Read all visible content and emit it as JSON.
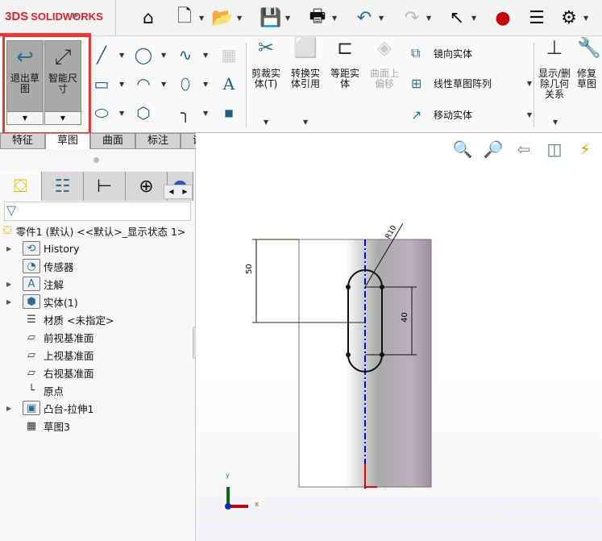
{
  "app": {
    "logo": "SOLIDWORKS",
    "logo_prefix": "3DS"
  },
  "quick_toolbar": [
    {
      "icon": "home-icon",
      "glyph": "⌂"
    },
    {
      "icon": "new-document-icon",
      "glyph": "🗋"
    },
    {
      "icon": "open-folder-icon",
      "glyph": "📂"
    },
    {
      "icon": "save-icon",
      "glyph": "💾"
    },
    {
      "icon": "print-icon",
      "glyph": "🖶"
    },
    {
      "icon": "undo-icon",
      "glyph": "↶"
    },
    {
      "icon": "redo-icon",
      "glyph": "↷"
    },
    {
      "icon": "select-pointer-icon",
      "glyph": "↖"
    },
    {
      "icon": "rebuild-traffic-light-icon",
      "glyph": "●"
    },
    {
      "icon": "file-properties-icon",
      "glyph": "☰"
    },
    {
      "icon": "options-gear-icon",
      "glyph": "⚙"
    }
  ],
  "ribbon": {
    "exit_sketch": "退出草图",
    "smart_dimension": "智能尺寸",
    "trim": "剪裁实体(T)",
    "convert": "转换实体引用",
    "offset": "等距实体",
    "surface_offset": "曲面上偏移",
    "mirror": "镜向实体",
    "linear_pattern": "线性草图阵列",
    "move": "移动实体",
    "display_relations": "显示/删除几何关系",
    "repair": "修复草图"
  },
  "tabs": [
    {
      "label": "特征"
    },
    {
      "label": "草图",
      "active": true
    },
    {
      "label": "曲面"
    },
    {
      "label": "标注"
    },
    {
      "label": "评估"
    }
  ],
  "tree": {
    "root": "零件1 (默认) <<默认>_显示状态 1>",
    "items": [
      {
        "label": "History",
        "expandable": true,
        "icon": "history-folder-icon"
      },
      {
        "label": "传感器",
        "expandable": false,
        "icon": "sensor-folder-icon"
      },
      {
        "label": "注解",
        "expandable": true,
        "icon": "annotations-folder-icon"
      },
      {
        "label": "实体(1)",
        "expandable": true,
        "icon": "solid-bodies-folder-icon"
      },
      {
        "label": "材质 <未指定>",
        "expandable": false,
        "icon": "material-icon"
      },
      {
        "label": "前视基准面",
        "expandable": false,
        "icon": "plane-icon"
      },
      {
        "label": "上视基准面",
        "expandable": false,
        "icon": "plane-icon"
      },
      {
        "label": "右视基准面",
        "expandable": false,
        "icon": "plane-icon"
      },
      {
        "label": "原点",
        "expandable": false,
        "icon": "origin-icon"
      },
      {
        "label": "凸台-拉伸1",
        "expandable": true,
        "icon": "extrude-icon"
      },
      {
        "label": "草图3",
        "expandable": false,
        "icon": "sketch-icon"
      }
    ]
  },
  "drawing": {
    "dim_height": "50",
    "dim_length": "40",
    "dim_radius": "R10",
    "axis_x": "x",
    "axis_y": "y"
  },
  "colors": {
    "accent": "#2c6f8f",
    "highlight": "#e33333",
    "centerline": "#0000ee"
  }
}
